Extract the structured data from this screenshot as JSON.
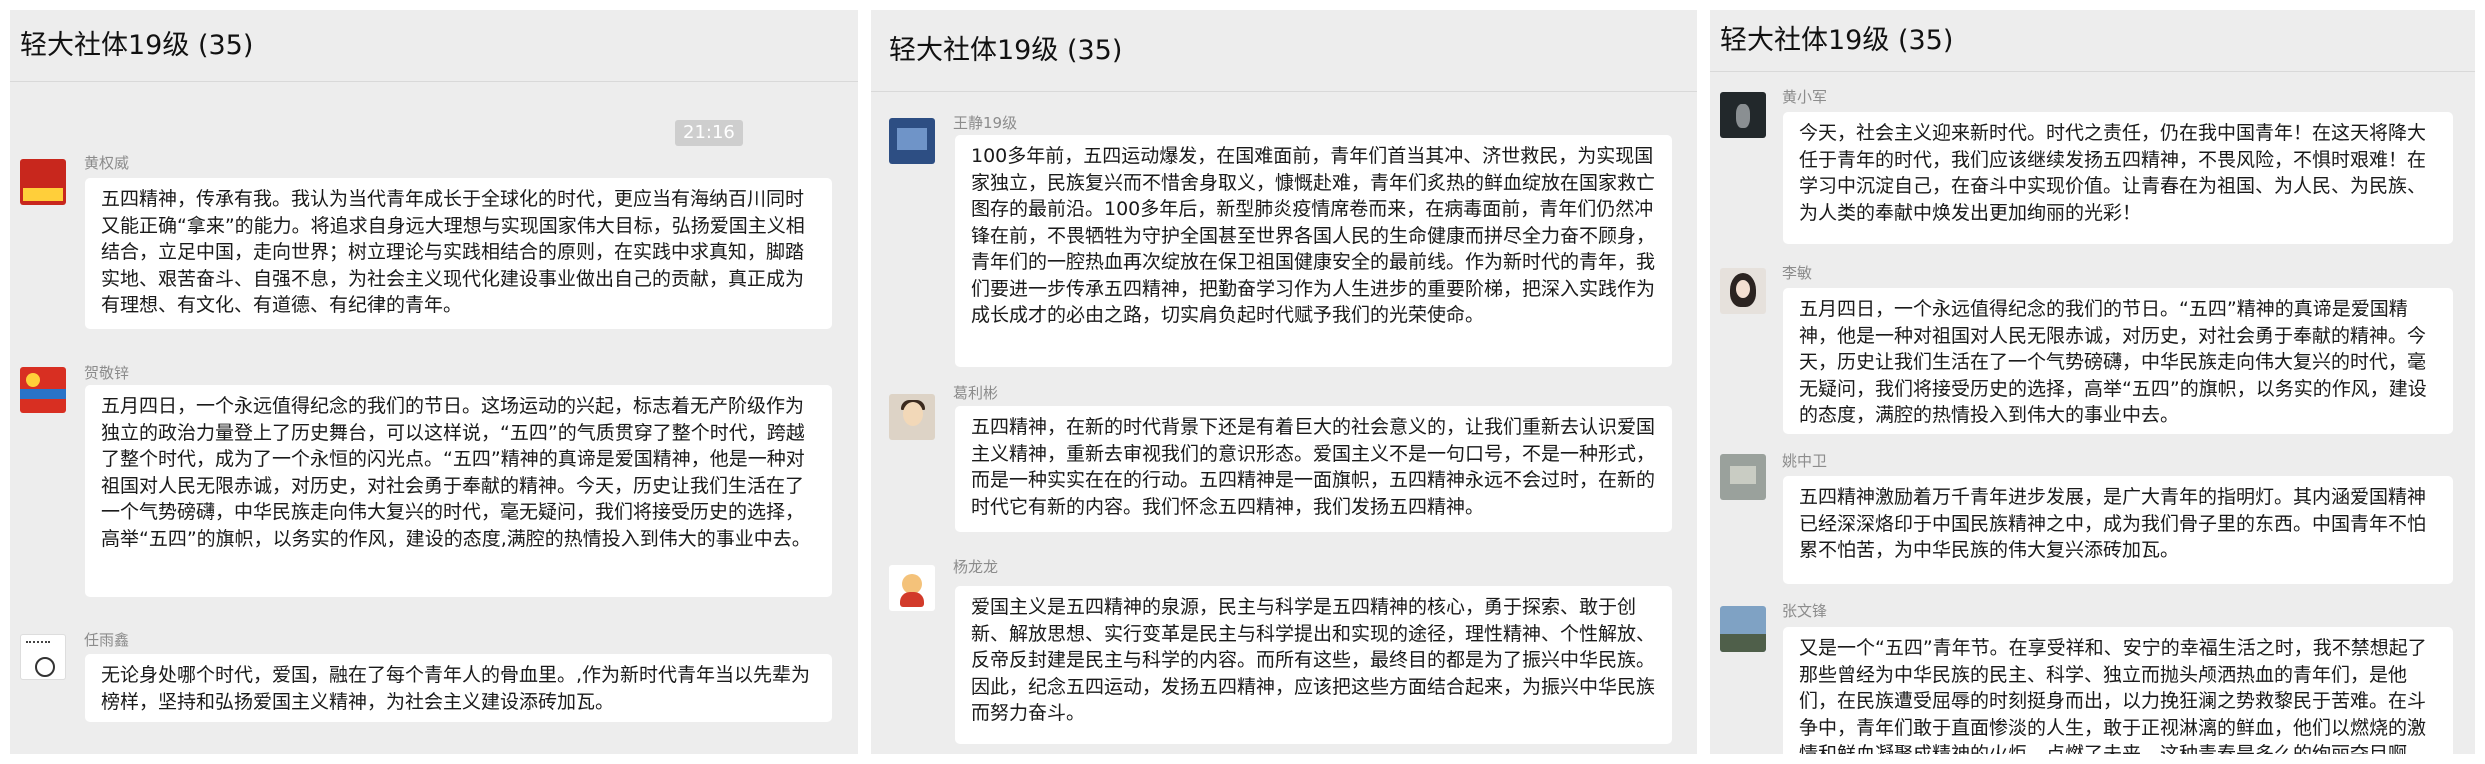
{
  "panels": [
    {
      "title": "轻大社体19级 (35)",
      "time": "21:16",
      "messages": [
        {
          "sender": "黄权威",
          "avatar": "red-badge-avatar",
          "text": "五四精神，传承有我。我认为当代青年成长于全球化的时代，更应当有海纳百川同时又能正确“拿来”的能力。将追求自身远大理想与实现国家伟大目标，弘扬爱国主义相结合，立足中国，走向世界；树立理论与实践相结合的原则，在实践中求真知，脚踏实地、艰苦奋斗、自强不息，为社会主义现代化建设事业做出自己的贡献，真正成为有理想、有文化、有道德、有纪律的青年。"
        },
        {
          "sender": "贺敬锌",
          "avatar": "flag-avatar",
          "text": "五月四日，一个永远值得纪念的我们的节日。这场运动的兴起，标志着无产阶级作为独立的政治力量登上了历史舞台，可以这样说，“五四”的气质贯穿了整个时代，跨越了整个时代，成为了一个永恒的闪光点。“五四”精神的真谛是爱国精神，他是一种对祖国对人民无限赤诚，对历史，对社会勇于奉献的精神。今天，历史让我们生活在了一个气势磅礴，中华民族走向伟大复兴的时代，毫无疑问，我们将接受历史的选择，高举“五四”的旗帜，以务实的作风，建设的态度,满腔的热情投入到伟大的事业中去。"
        },
        {
          "sender": "任雨鑫",
          "avatar": "doodle-avatar",
          "text": "无论身处哪个时代，爱国，融在了每个青年人的骨血里。,作为新时代青年当以先辈为榜样，坚持和弘扬爱国主义精神，为社会主义建设添砖加瓦。"
        }
      ]
    },
    {
      "title": "轻大社体19级 (35)",
      "messages": [
        {
          "sender": "王静19级",
          "avatar": "blue-photo-avatar",
          "text": "100多年前，五四运动爆发，在国难面前，青年们首当其冲、济世救民，为实现国家独立，民族复兴而不惜舍身取义，慷慨赴难，青年们炙热的鲜血绽放在国家救亡图存的最前沿。100多年后，新型肺炎疫情席卷而来，在病毒面前，青年们仍然冲锋在前，不畏牺牲为守护全国甚至世界各国人民的生命健康而拼尽全力奋不顾身，青年们的一腔热血再次绽放在保卫祖国健康安全的最前线。作为新时代的青年，我们要进一步传承五四精神，把勤奋学习作为人生进步的重要阶梯，把深入实践作为成长成才的必由之路，切实肩负起时代赋予我们的光荣使命。"
        },
        {
          "sender": "葛利彬",
          "avatar": "child-photo-avatar",
          "text": "五四精神，在新的时代背景下还是有着巨大的社会意义的，让我们重新去认识爱国主义精神，重新去审视我们的意识形态。爱国主义不是一句口号，不是一种形式，而是一种实实在在的行动。五四精神是一面旗帜，五四精神永远不会过时，在新的时代它有新的内容。我们怀念五四精神，我们发扬五四精神。"
        },
        {
          "sender": "杨龙龙",
          "avatar": "cartoon-avatar",
          "text": "爱国主义是五四精神的泉源，民主与科学是五四精神的核心，勇于探索、敢于创新、解放思想、实行变革是民主与科学提出和实现的途径，理性精神、个性解放、反帝反封建是民主与科学的内容。而所有这些，最终目的都是为了振兴中华民族。因此，纪念五四运动，发扬五四精神，应该把这些方面结合起来，为振兴中华民族而努力奋斗。"
        }
      ]
    },
    {
      "title": "轻大社体19级 (35)",
      "messages": [
        {
          "sender": "黄小军",
          "avatar": "dark-photo-avatar",
          "text": "今天，社会主义迎来新时代。时代之责任，仍在我中国青年！在这天将降大任于青年的时代，我们应该继续发扬五四精神，不畏风险，不惧时艰难！在学习中沉淀自己，在奋斗中实现价值。让青春在为祖国、为人民、为民族、为人类的奉献中焕发出更加绚丽的光彩！"
        },
        {
          "sender": "李敏",
          "avatar": "portrait-avatar",
          "text": "五月四日，一个永远值得纪念的我们的节日。“五四”精神的真谛是爱国精神，他是一种对祖国对人民无限赤诚，对历史，对社会勇于奉献的精神。今天，历史让我们生活在了一个气势磅礴，中华民族走向伟大复兴的时代，毫无疑问，我们将接受历史的选择，高举“五四”的旗帜，以务实的作风，建设的态度，满腔的热情投入到伟大的事业中去。"
        },
        {
          "sender": "姚中卫",
          "avatar": "grey-photo-avatar",
          "text": "五四精神激励着万千青年进步发展，是广大青年的指明灯。其内涵爱国精神已经深深烙印于中国民族精神之中，成为我们骨子里的东西。中国青年不怕累不怕苦，为中华民族的伟大复兴添砖加瓦。"
        },
        {
          "sender": "张文锋",
          "avatar": "landscape-avatar",
          "text": "又是一个“五四”青年节。在享受祥和、安宁的幸福生活之时，我不禁想起了那些曾经为中华民族的民主、科学、独立而抛头颅洒热血的青年们，是他们，在民族遭受屈辱的时刻挺身而出，以力挽狂澜之势救黎民于苦难。在斗争中，青年们敢于直面惨淡的人生，敢于正视淋漓的鲜血，他们以燃烧的激情和鲜血凝聚成精神的火炬，点燃了未来。这种青春是多么的绚丽夺目啊，这种使命感"
        }
      ]
    }
  ]
}
